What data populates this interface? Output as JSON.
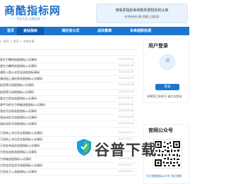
{
  "header": {
    "logo_title": "商酷指标网",
    "logo_slogan": "—— 专业大全 让股友选 ——",
    "banner_line1": "用股票指标系统助你更轻松的认知",
    "banner_line2": "给你带来行情 把握上涨趋势"
  },
  "nav": {
    "items": [
      {
        "label": "首页",
        "active": false
      },
      {
        "label": "金钻指标",
        "active": true
      },
      {
        "label": "通达信公式",
        "active": false
      },
      {
        "label": "战法集锦",
        "active": false
      },
      {
        "label": "未来函数检测",
        "active": false
      }
    ]
  },
  "breadcrumb": {
    "home": "首页",
    "sep1": ">",
    "section": "首页",
    "sep2": ">",
    "current": "本地文章"
  },
  "list": {
    "items": [
      {
        "title": "源主力撒网选股指标公式源码",
        "date": "2023-03-18"
      },
      {
        "title": "源主力撒网选股指标公式源码",
        "date": "2023-03-18"
      },
      {
        "title": "源投入版公式优化选股指标源码",
        "date": "2023-03-18"
      },
      {
        "title": "源机加上漲优质选股指标公式源码",
        "date": "2023-03-18"
      },
      {
        "title": "起涨黑马选股指标公式源码",
        "date": "2023-03-18"
      },
      {
        "title": "起涨黑马选股指标公式源码",
        "date": "2023-03-18"
      },
      {
        "title": "源主力资金选股指标公式源码",
        "date": "2023-03-18"
      },
      {
        "title": "源平均的主力突破选股指标公式源码",
        "date": "2023-03-18"
      },
      {
        "title": "涨信号出现选股指标公式源码",
        "date": "2023-03-18"
      },
      {
        "title": "涨启动信号选股指标公式源码",
        "date": "2023-03-18"
      },
      {
        "title": "源启动信号选股指标公式源码",
        "date": "2023-03-18"
      },
      {
        "title": "万进场上车后优支股指标公式源码",
        "date": "2023-03-17"
      },
      {
        "title": "万进场上车后优支股指标公式源码",
        "date": "2023-03-17"
      },
      {
        "title": "万资金布局优选股指标公式源码",
        "date": "2023-03-17"
      },
      {
        "title": "力资金追踪选股指标公式源码",
        "date": "2023-03-17"
      },
      {
        "title": "力突破选股指标公式源码",
        "date": "2023-03-17"
      },
      {
        "title": "力资金资金信号选股指标公式源码",
        "date": "2023-03-17"
      },
      {
        "title": "力资金大入选股指标公式源码",
        "date": "2023-03-17"
      }
    ]
  },
  "sidebar": {
    "login_title": "用户登录",
    "login_button": "登录",
    "login_tip": "如果您已有账号,请点击登录",
    "qr_title": "官网公众号",
    "qr_caption": "关注商酷指标公众号 每日更新"
  },
  "watermark": {
    "text": "谷普下载"
  },
  "colors": {
    "brand": "#1d75d0",
    "nav_active": "#0d5cb0"
  }
}
